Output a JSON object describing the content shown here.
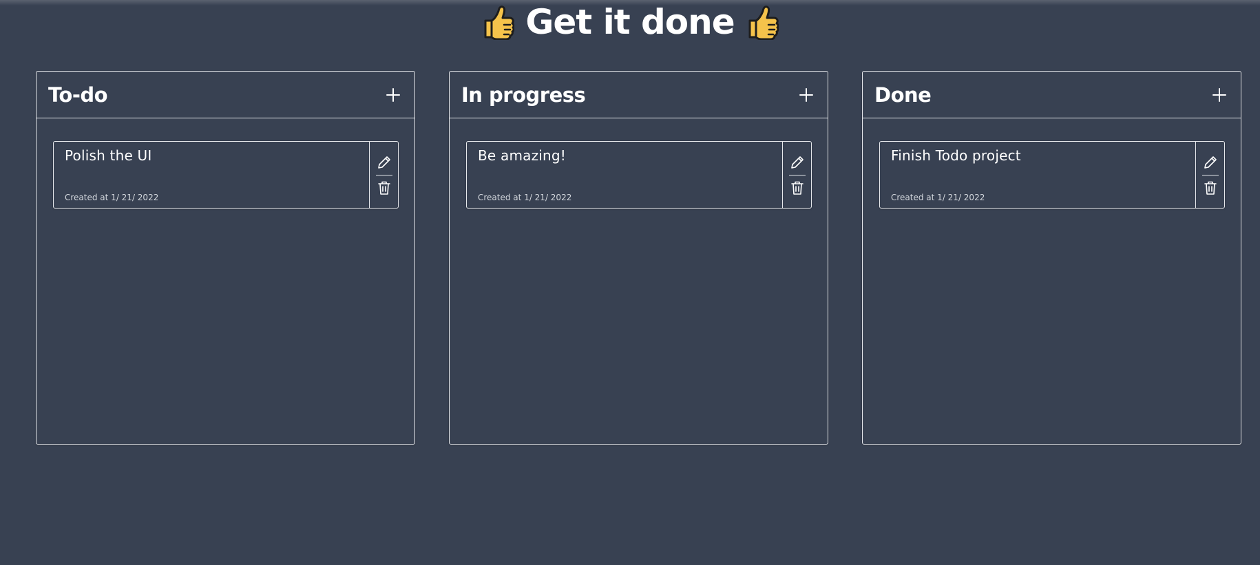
{
  "app": {
    "title": "Get it done",
    "title_icon": "thumbs-up-icon"
  },
  "colors": {
    "background": "#384152",
    "border": "#e6e8ec",
    "text": "#ffffff",
    "thumb": "#f5c34b"
  },
  "boards": [
    {
      "title": "To-do",
      "add_icon": "plus-icon",
      "cards": [
        {
          "text": "Polish the UI",
          "created": "Created at 1/ 21/ 2022"
        }
      ]
    },
    {
      "title": "In progress",
      "add_icon": "plus-icon",
      "cards": [
        {
          "text": "Be amazing!",
          "created": "Created at 1/ 21/ 2022"
        }
      ]
    },
    {
      "title": "Done",
      "add_icon": "plus-icon",
      "cards": [
        {
          "text": "Finish Todo project",
          "created": "Created at 1/ 21/ 2022"
        }
      ]
    }
  ],
  "card_actions": {
    "edit_icon": "pencil-icon",
    "delete_icon": "trash-icon"
  }
}
